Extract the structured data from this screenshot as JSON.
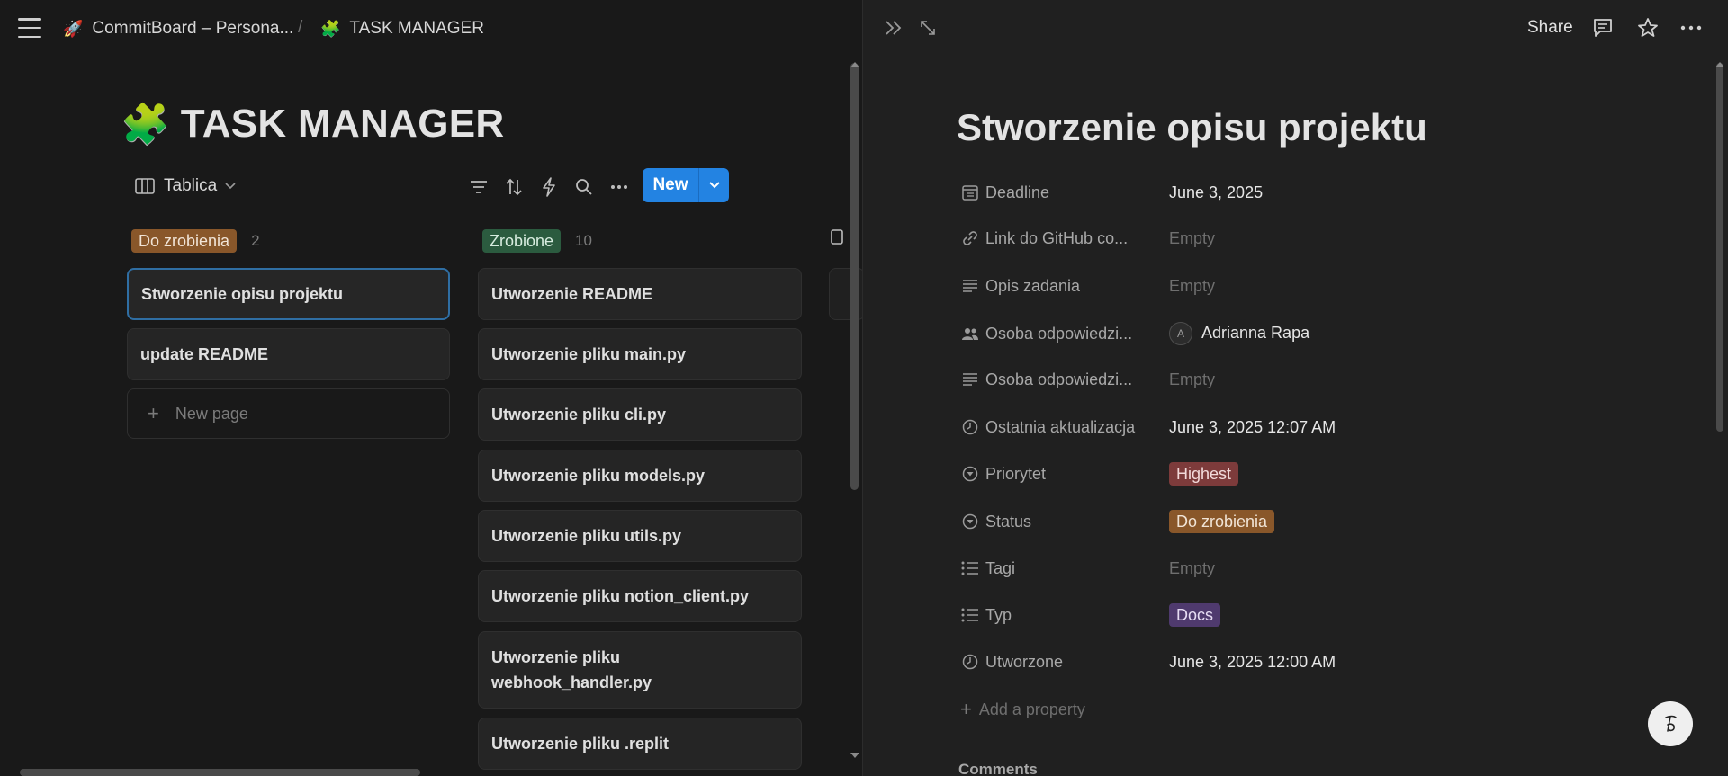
{
  "breadcrumb": {
    "workspace_icon": "🚀",
    "workspace_label": "CommitBoard – Persona...",
    "separator": "/",
    "page_icon": "🧩",
    "page_label": "TASK MANAGER"
  },
  "database": {
    "title_icon": "🧩",
    "title": "TASK MANAGER",
    "view_label": "Tablica",
    "new_button_label": "New",
    "toolbar_icons": [
      "filter-icon",
      "sort-icon",
      "automation-icon",
      "search-icon",
      "more-icon"
    ]
  },
  "columns": [
    {
      "status": "Do zrobienia",
      "count": "2",
      "color": "#89572a",
      "cards": [
        "Stworzenie opisu projektu",
        "update README"
      ],
      "new_page_label": "New page"
    },
    {
      "status": "Zrobione",
      "count": "10",
      "color": "#2b5b3f",
      "cards": [
        "Utworzenie README",
        "Utworzenie pliku main.py",
        "Utworzenie pliku cli.py",
        "Utworzenie pliku models.py",
        "Utworzenie pliku utils.py",
        "Utworzenie pliku notion_client.py",
        "Utworzenie pliku webhook_handler.py",
        "Utworzenie pliku .replit"
      ]
    }
  ],
  "detail": {
    "share_label": "Share",
    "title": "Stworzenie opisu projektu",
    "properties": [
      {
        "icon": "calendar-icon",
        "name": "Deadline",
        "value": "June 3, 2025",
        "type": "text"
      },
      {
        "icon": "link-icon",
        "name": "Link do GitHub co...",
        "value": "Empty",
        "type": "empty"
      },
      {
        "icon": "text-icon",
        "name": "Opis zadania",
        "value": "Empty",
        "type": "empty"
      },
      {
        "icon": "people-icon",
        "name": "Osoba odpowiedzi...",
        "value": "Adrianna Rapa",
        "avatar": "A",
        "type": "person"
      },
      {
        "icon": "text-icon",
        "name": "Osoba odpowiedzi...",
        "value": "Empty",
        "type": "empty"
      },
      {
        "icon": "clock-icon",
        "name": "Ostatnia aktualizacja",
        "value": "June 3, 2025 12:07 AM",
        "type": "text"
      },
      {
        "icon": "select-icon",
        "name": "Priorytet",
        "value": "Highest",
        "type": "tag",
        "color": "#7d3b3b"
      },
      {
        "icon": "select-icon",
        "name": "Status",
        "value": "Do zrobienia",
        "type": "tag",
        "color": "#89572a"
      },
      {
        "icon": "list-icon",
        "name": "Tagi",
        "value": "Empty",
        "type": "empty"
      },
      {
        "icon": "list-icon",
        "name": "Typ",
        "value": "Docs",
        "type": "tag",
        "color": "#4f3a6e"
      },
      {
        "icon": "clock-icon",
        "name": "Utworzone",
        "value": "June 3, 2025 12:00 AM",
        "type": "text"
      }
    ],
    "add_property_label": "Add a property",
    "comments_label": "Comments"
  }
}
